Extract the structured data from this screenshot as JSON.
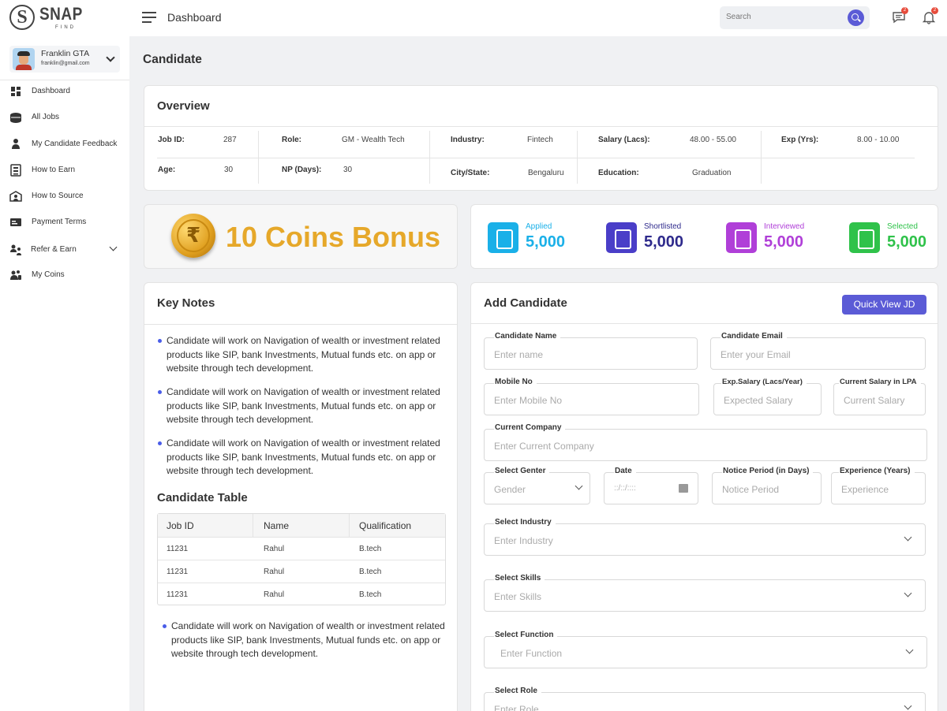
{
  "app": {
    "logo_main": "SNAP",
    "logo_sub": "FIND",
    "logo_letter": "S",
    "page_header": "Dashboard",
    "search_placeholder": "Search",
    "messages_count": "2",
    "notifications_count": "2"
  },
  "user": {
    "name": "Franklin GTA",
    "email": "franklin@gmail.com"
  },
  "sidebar": {
    "items": [
      {
        "label": "Dashboard",
        "icon": "dashboard-icon"
      },
      {
        "label": "All Jobs",
        "icon": "jobs-icon"
      },
      {
        "label": "My Candidate Feedback",
        "icon": "feedback-icon"
      },
      {
        "label": "How to Earn",
        "icon": "earn-icon"
      },
      {
        "label": "How to Source",
        "icon": "source-icon"
      },
      {
        "label": "Payment Terms",
        "icon": "payment-icon"
      },
      {
        "label": "Refer & Earn",
        "icon": "refer-icon"
      },
      {
        "label": "My Coins",
        "icon": "coins-icon"
      }
    ]
  },
  "page": {
    "title": "Candidate"
  },
  "overview": {
    "title": "Overview",
    "row1": [
      {
        "label": "Job ID:",
        "value": "287"
      },
      {
        "label": "Role:",
        "value": "GM - Wealth Tech"
      },
      {
        "label": "Industry:",
        "value": "Fintech"
      },
      {
        "label": "Salary (Lacs):",
        "value": "48.00 - 55.00"
      },
      {
        "label": "Exp (Yrs):",
        "value": "8.00 - 10.00"
      }
    ],
    "row2": [
      {
        "label": "Age:",
        "value": "30"
      },
      {
        "label": "NP (Days):",
        "value": "30"
      },
      {
        "label": "City/State:",
        "value": "Bengaluru"
      },
      {
        "label": "Education:",
        "value": "Graduation"
      }
    ]
  },
  "bonus": {
    "text": "10 Coins Bonus",
    "symbol": "₹"
  },
  "stats": [
    {
      "label": "Applied",
      "value": "5,000",
      "color": "#1ab0e8",
      "box": "#1ab0e8",
      "icon": "applied-icon"
    },
    {
      "label": "Shortlisted",
      "value": "5,000",
      "color": "#2e2a8c",
      "box": "#4a3ec8",
      "icon": "shortlisted-icon"
    },
    {
      "label": "Interviewed",
      "value": "5,000",
      "color": "#b03fd8",
      "box": "#b03fd8",
      "icon": "interviewed-icon"
    },
    {
      "label": "Selected",
      "value": "5,000",
      "color": "#2fc24a",
      "box": "#2fc24a",
      "icon": "selected-icon"
    }
  ],
  "key_notes": {
    "title": "Key Notes",
    "bullets": [
      "Candidate will work on Navigation of wealth or  investment related products like SIP, bank Investments, Mutual funds  etc. on app or website through tech development.",
      "Candidate will work on Navigation of wealth or  investment related products like SIP, bank Investments, Mutual funds  etc. on app or website through tech development.",
      "Candidate will work on Navigation of wealth or  investment related products like SIP, bank Investments, Mutual funds  etc. on app or website through tech development."
    ],
    "table_title": "Candidate Table",
    "table_headers": [
      "Job ID",
      "Name",
      "Qualification"
    ],
    "table_rows": [
      [
        "11231",
        "Rahul",
        "B.tech"
      ],
      [
        "11231",
        "Rahul",
        "B.tech"
      ],
      [
        "11231",
        "Rahul",
        "B.tech"
      ]
    ],
    "footer_bullet": "Candidate will work on Navigation of wealth or  investment related products like SIP, bank Investments, Mutual funds  etc. on app or website through tech development."
  },
  "add_candidate": {
    "title": "Add Candidate",
    "quick_view": "Quick View JD",
    "fields": {
      "name": {
        "label": "Candidate Name",
        "placeholder": "Enter name"
      },
      "email": {
        "label": "Candidate Email",
        "placeholder": "Enter your Email"
      },
      "mobile": {
        "label": "Mobile No",
        "placeholder": "Enter Mobile No"
      },
      "exp_salary": {
        "label": "Exp.Salary (Lacs/Year)",
        "placeholder": "Expected Salary"
      },
      "cur_salary": {
        "label": "Current Salary in LPA",
        "placeholder": "Current Salary"
      },
      "company": {
        "label": "Current Company",
        "placeholder": "Enter Current Company"
      },
      "gender": {
        "label": "Select Genter",
        "placeholder": "Gender"
      },
      "date": {
        "label": "Date",
        "placeholder": "::/::/::::"
      },
      "notice": {
        "label": "Notice Period (in Days)",
        "placeholder": "Notice Period"
      },
      "experience": {
        "label": "Experience (Years)",
        "placeholder": "Experience"
      },
      "industry": {
        "label": "Select Industry",
        "placeholder": "Enter Industry"
      },
      "skills": {
        "label": "Select Skills",
        "placeholder": "Enter Skills"
      },
      "function": {
        "label": "Select Function",
        "placeholder": "Enter Function"
      },
      "role": {
        "label": "Select Role",
        "placeholder": "Enter Role"
      }
    }
  }
}
